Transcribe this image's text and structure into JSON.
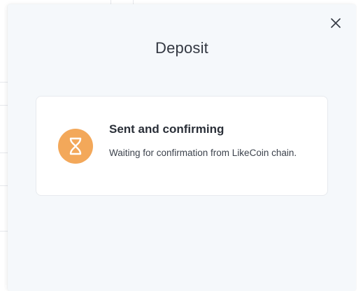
{
  "modal": {
    "title": "Deposit",
    "close_icon": "close-icon"
  },
  "status": {
    "icon": "hourglass-icon",
    "icon_color": "#f3a85a",
    "heading": "Sent and confirming",
    "description": "Waiting for confirmation from LikeCoin chain."
  }
}
